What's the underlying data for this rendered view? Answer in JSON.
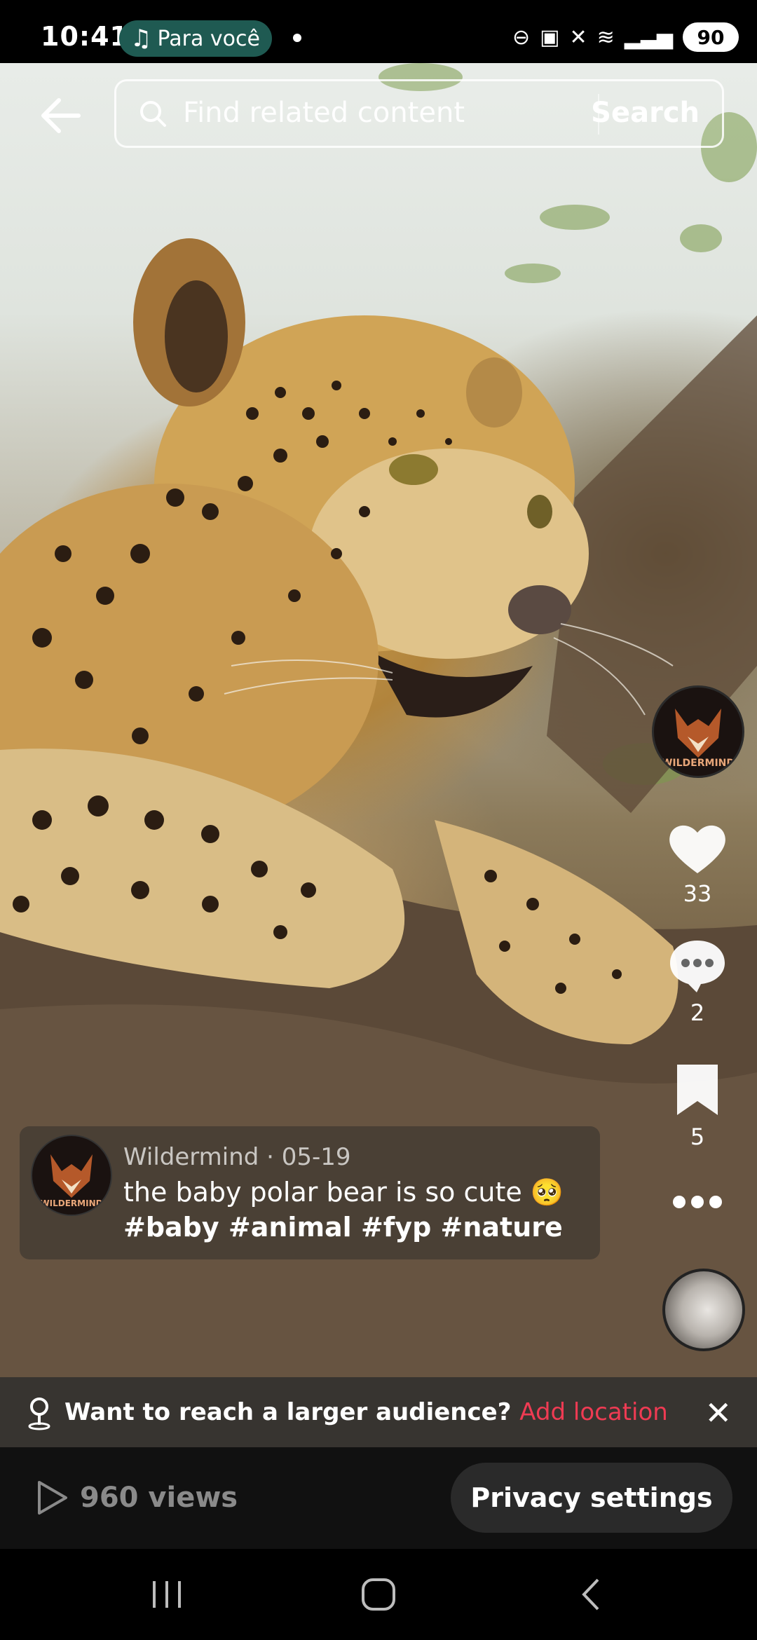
{
  "status_bar": {
    "time": "10:41",
    "media_pill": "Para você",
    "battery": "90",
    "icons": [
      "minus-circle-icon",
      "lock-icon",
      "mute-icon",
      "wifi-icon",
      "signal-icon"
    ]
  },
  "search": {
    "placeholder": "Find related content",
    "button_label": "Search"
  },
  "right_rail": {
    "avatar_label": "WILDERMIND",
    "likes": "33",
    "comments": "2",
    "saves": "5"
  },
  "caption": {
    "avatar_label": "WILDERMIND",
    "author": "Wildermind",
    "date": "05-19",
    "meta": "Wildermind · 05-19",
    "text": "the baby polar bear is so cute 🥺",
    "hashtags": "#baby #animal #fyp #nature"
  },
  "location_banner": {
    "message": "Want to reach a larger audience?",
    "link": "Add location"
  },
  "bottom": {
    "views": "960 views",
    "privacy_button": "Privacy settings"
  },
  "colors": {
    "accent_link": "#ef3b53",
    "pill_bg": "#1f5a52"
  }
}
